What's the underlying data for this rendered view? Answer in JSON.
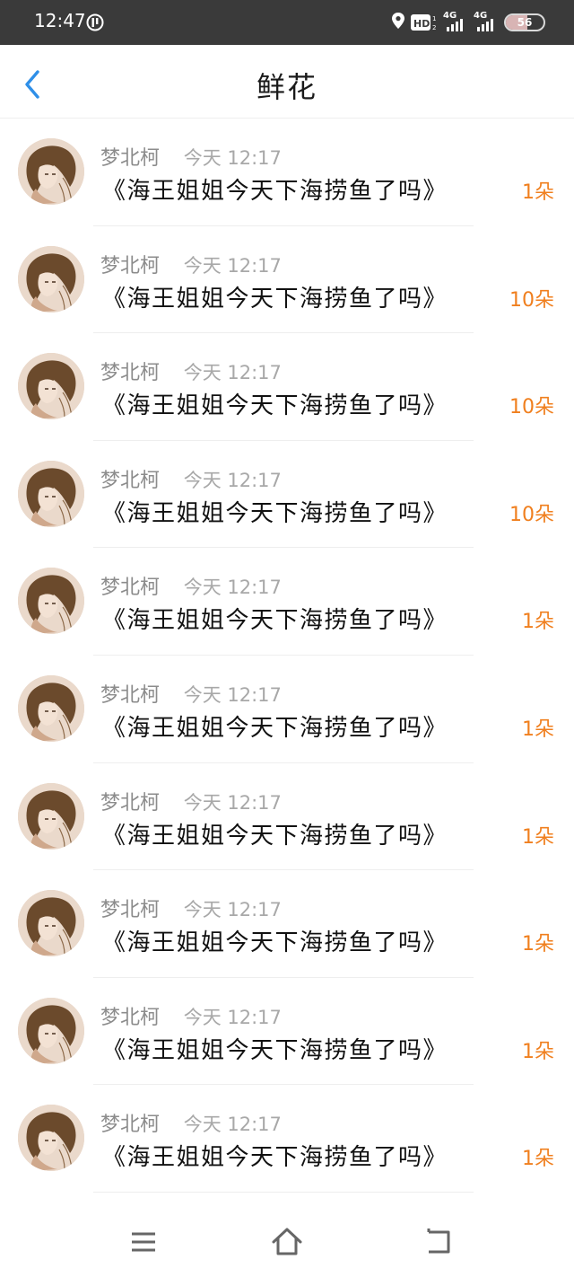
{
  "status_bar": {
    "time": "12:47",
    "signal1_label": "4G",
    "signal2_label": "4G",
    "hd_label": "HD",
    "battery_level": "56"
  },
  "header": {
    "title": "鲜花"
  },
  "records": [
    {
      "name": "梦北柯",
      "time": "今天 12:17",
      "title": "《海王姐姐今天下海捞鱼了吗》",
      "count": "1朵"
    },
    {
      "name": "梦北柯",
      "time": "今天 12:17",
      "title": "《海王姐姐今天下海捞鱼了吗》",
      "count": "10朵"
    },
    {
      "name": "梦北柯",
      "time": "今天 12:17",
      "title": "《海王姐姐今天下海捞鱼了吗》",
      "count": "10朵"
    },
    {
      "name": "梦北柯",
      "time": "今天 12:17",
      "title": "《海王姐姐今天下海捞鱼了吗》",
      "count": "10朵"
    },
    {
      "name": "梦北柯",
      "time": "今天 12:17",
      "title": "《海王姐姐今天下海捞鱼了吗》",
      "count": "1朵"
    },
    {
      "name": "梦北柯",
      "time": "今天 12:17",
      "title": "《海王姐姐今天下海捞鱼了吗》",
      "count": "1朵"
    },
    {
      "name": "梦北柯",
      "time": "今天 12:17",
      "title": "《海王姐姐今天下海捞鱼了吗》",
      "count": "1朵"
    },
    {
      "name": "梦北柯",
      "time": "今天 12:17",
      "title": "《海王姐姐今天下海捞鱼了吗》",
      "count": "1朵"
    },
    {
      "name": "梦北柯",
      "time": "今天 12:17",
      "title": "《海王姐姐今天下海捞鱼了吗》",
      "count": "1朵"
    },
    {
      "name": "梦北柯",
      "time": "今天 12:17",
      "title": "《海王姐姐今天下海捞鱼了吗》",
      "count": "1朵"
    }
  ],
  "colors": {
    "accent_blue": "#2f8fe8",
    "count_orange": "#f07f1e",
    "status_bar_bg": "#3a3a3a"
  },
  "icons": {
    "back": "chevron-left-icon",
    "menu": "menu-icon",
    "home": "home-icon",
    "return": "return-icon"
  }
}
